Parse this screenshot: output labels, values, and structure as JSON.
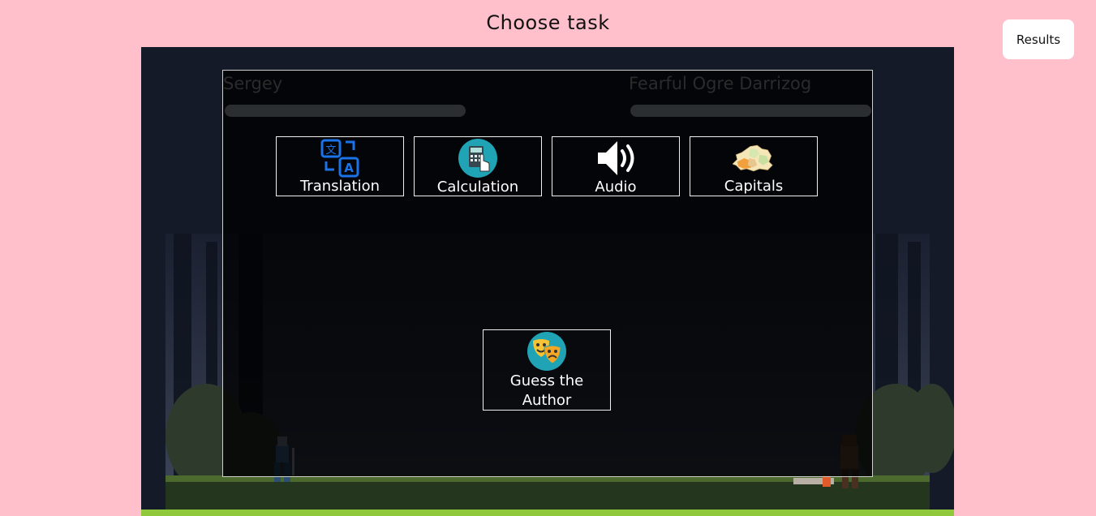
{
  "header": {
    "title": "Choose task"
  },
  "results_button": {
    "label": "Results"
  },
  "players": {
    "player": {
      "name": "Sergey",
      "health": 1.0
    },
    "enemy": {
      "name": "Fearful Ogre Darrizog",
      "health": 1.0
    }
  },
  "tasks": [
    {
      "label": "Translation",
      "icon": "translate-icon"
    },
    {
      "label": "Calculation",
      "icon": "calculator-icon"
    },
    {
      "label": "Audio",
      "icon": "speaker-icon"
    },
    {
      "label": "Capitals",
      "icon": "map-icon"
    },
    {
      "label": "Guess the Author",
      "icon": "theater-masks-icon"
    }
  ],
  "colors": {
    "page_background": "#ffc0cb",
    "game_background": "#121725",
    "grass": "#8fc83a",
    "icon_blue": "#1a73e8",
    "icon_teal": "#1fa3b5"
  }
}
